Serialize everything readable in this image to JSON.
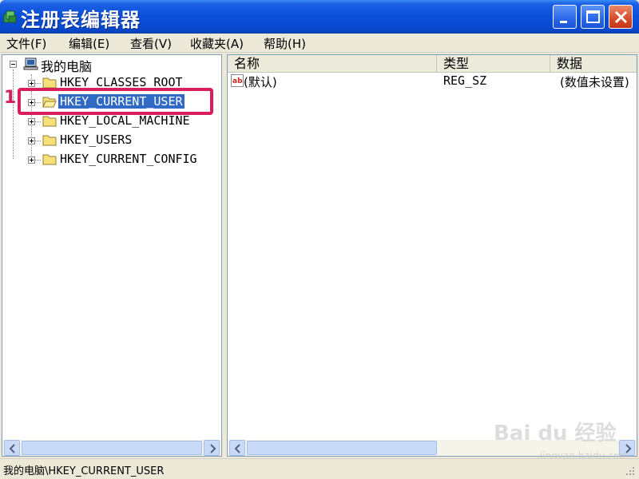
{
  "window": {
    "title": "注册表编辑器",
    "controls": {
      "minimize": "minimize",
      "maximize": "maximize",
      "close": "close"
    }
  },
  "menu": [
    {
      "label": "文件(F)"
    },
    {
      "label": "编辑(E)"
    },
    {
      "label": "查看(V)"
    },
    {
      "label": "收藏夹(A)"
    },
    {
      "label": "帮助(H)"
    }
  ],
  "tree": {
    "root": "我的电脑",
    "items": [
      {
        "label": "HKEY_CLASSES_ROOT",
        "selected": false
      },
      {
        "label": "HKEY_CURRENT_USER",
        "selected": true
      },
      {
        "label": "HKEY_LOCAL_MACHINE",
        "selected": false
      },
      {
        "label": "HKEY_USERS",
        "selected": false
      },
      {
        "label": "HKEY_CURRENT_CONFIG",
        "selected": false
      }
    ]
  },
  "annotation": {
    "step": "1",
    "color": "#d81e5b"
  },
  "list": {
    "columns": [
      "名称",
      "类型",
      "数据"
    ],
    "rows": [
      {
        "name": "(默认)",
        "type": "REG_SZ",
        "data": "(数值未设置)",
        "icon": "string-value-icon"
      }
    ]
  },
  "status": {
    "path": "我的电脑\\HKEY_CURRENT_USER"
  },
  "watermark": {
    "brand": "Bai du 经验",
    "url": "jingyan.baidu.com"
  },
  "colors": {
    "titlebar": "#0a4fd8",
    "selection": "#316ac5",
    "highlight": "#d81e5b"
  }
}
